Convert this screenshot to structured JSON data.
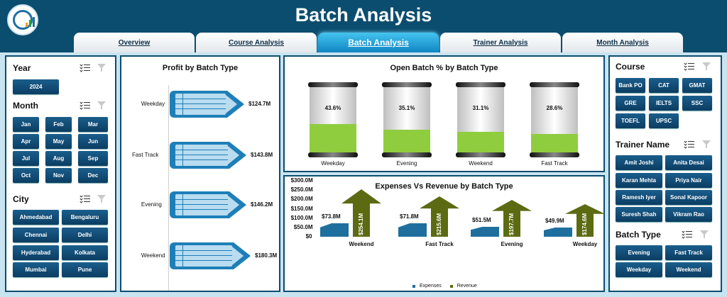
{
  "header": {
    "title": "Batch Analysis"
  },
  "tabs": [
    {
      "label": "Overview"
    },
    {
      "label": "Course Analysis"
    },
    {
      "label": "Batch Analysis"
    },
    {
      "label": "Trainer Analysis"
    },
    {
      "label": "Month Analysis"
    }
  ],
  "slicers": {
    "year": {
      "title": "Year",
      "items": [
        "2024"
      ]
    },
    "month": {
      "title": "Month",
      "items": [
        "Jan",
        "Feb",
        "Mar",
        "Apr",
        "May",
        "Jun",
        "Jul",
        "Aug",
        "Sep",
        "Oct",
        "Nov",
        "Dec"
      ]
    },
    "city": {
      "title": "City",
      "items": [
        "Ahmedabad",
        "Bengaluru",
        "Chennai",
        "Delhi",
        "Hyderabad",
        "Kolkata",
        "Mumbai",
        "Pune"
      ]
    },
    "course": {
      "title": "Course",
      "items": [
        "Bank PO",
        "CAT",
        "GMAT",
        "GRE",
        "IELTS",
        "SSC",
        "TOEFL",
        "UPSC"
      ]
    },
    "trainer": {
      "title": "Trainer Name",
      "items": [
        "Amit Joshi",
        "Anita Desai",
        "Karan Mehta",
        "Priya Nair",
        "Ramesh Iyer",
        "Sonal Kapoor",
        "Suresh Shah",
        "Vikram Rao"
      ]
    },
    "batch_type": {
      "title": "Batch Type",
      "items": [
        "Evening",
        "Fast Track",
        "Weekday",
        "Weekend"
      ]
    }
  },
  "chart_data": [
    {
      "type": "bar",
      "title": "Profit by Batch Type",
      "categories": [
        "Weekday",
        "Fast Track",
        "Evening",
        "Weekend"
      ],
      "values": [
        124.7,
        143.8,
        146.2,
        180.3
      ],
      "labels": [
        "$124.7M",
        "$143.8M",
        "$146.2M",
        "$180.3M"
      ],
      "color": "#1e7fb8"
    },
    {
      "type": "bar",
      "title": "Open Batch % by Batch Type",
      "categories": [
        "Weekday",
        "Evening",
        "Weekend",
        "Fast Track"
      ],
      "values": [
        43.6,
        35.1,
        31.1,
        28.6
      ],
      "labels": [
        "43.6%",
        "35.1%",
        "31.1%",
        "28.6%"
      ],
      "color": "#8fcd3f"
    },
    {
      "type": "bar",
      "title": "Expenses Vs Revenue by Batch Type",
      "categories": [
        "Weekend",
        "Fast Track",
        "Evening",
        "Weekday"
      ],
      "ylim": [
        0,
        300
      ],
      "yticks": [
        "$0",
        "$50.0M",
        "$100.0M",
        "$150.0M",
        "$200.0M",
        "$250.0M",
        "$300.0M"
      ],
      "legend": "bottom",
      "series": [
        {
          "name": "Expenses",
          "values": [
            73.8,
            71.8,
            51.5,
            49.9
          ],
          "labels": [
            "$73.8M",
            "$71.8M",
            "$51.5M",
            "$49.9M"
          ],
          "color": "#1f6f9e"
        },
        {
          "name": "Revenue",
          "values": [
            254.1,
            215.6,
            197.7,
            174.6
          ],
          "labels": [
            "$254.1M",
            "$215.6M",
            "$197.7M",
            "$174.6M"
          ],
          "color": "#5c6b12"
        }
      ]
    }
  ]
}
